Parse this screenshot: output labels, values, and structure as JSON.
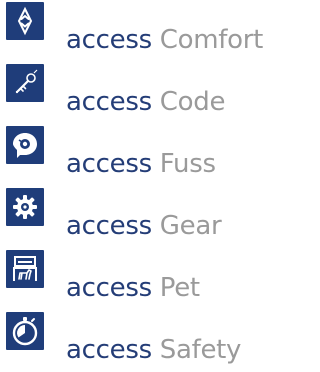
{
  "colors": {
    "badge_bg": "#1f3d7a",
    "prefix_text": "#243d77",
    "suffix_text": "#9a9a9a"
  },
  "items": [
    {
      "prefix": "access",
      "name": "Comfort",
      "icon": "comfort-icon"
    },
    {
      "prefix": "access",
      "name": "Code",
      "icon": "code-key-icon"
    },
    {
      "prefix": "access",
      "name": "Fuss",
      "icon": "fuss-icon"
    },
    {
      "prefix": "access",
      "name": "Gear",
      "icon": "gear-icon"
    },
    {
      "prefix": "access",
      "name": "Pet",
      "icon": "pet-icon"
    },
    {
      "prefix": "access",
      "name": "Safety",
      "icon": "safety-icon"
    }
  ]
}
